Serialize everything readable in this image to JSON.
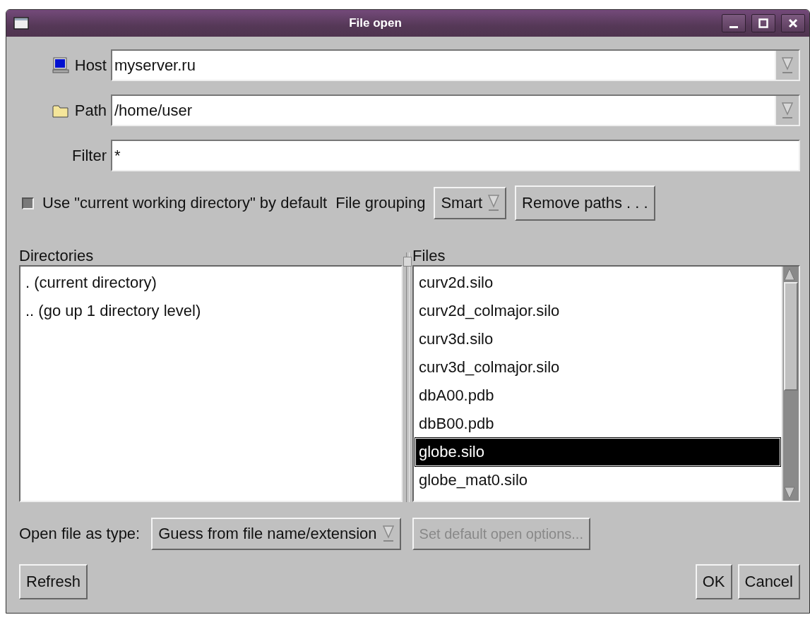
{
  "window": {
    "title": "File open"
  },
  "fields": [
    {
      "kind": "combo",
      "label": "Host",
      "value": "myserver.ru"
    },
    {
      "kind": "combo",
      "label": "Path",
      "value": "/home/user"
    },
    {
      "kind": "text",
      "label": "Filter",
      "value": "*"
    }
  ],
  "options": {
    "checkbox": {
      "label": "Use \"current working directory\" by default",
      "checked": false
    },
    "grouping_label": "File grouping",
    "grouping_value": "Smart",
    "remove_button": "Remove paths . . ."
  },
  "directories": {
    "title": "Directories",
    "items": [
      {
        "label": ". (current directory)",
        "selected": false
      },
      {
        "label": ".. (go up 1 directory level)",
        "selected": false
      }
    ]
  },
  "files": {
    "title": "Files",
    "items": [
      {
        "label": "curv2d.silo",
        "selected": false
      },
      {
        "label": "curv2d_colmajor.silo",
        "selected": false
      },
      {
        "label": "curv3d.silo",
        "selected": false
      },
      {
        "label": "curv3d_colmajor.silo",
        "selected": false
      },
      {
        "label": "dbA00.pdb",
        "selected": false
      },
      {
        "label": "dbB00.pdb",
        "selected": false
      },
      {
        "label": "globe.silo",
        "selected": true
      },
      {
        "label": "globe_mat0.silo",
        "selected": false
      }
    ]
  },
  "open_type": {
    "label": "Open file as type:",
    "value": "Guess from file name/extension",
    "options_button": {
      "label": "Set default open options...",
      "disabled": true
    }
  },
  "buttons": {
    "refresh": "Refresh",
    "ok": "OK",
    "cancel": "Cancel"
  }
}
